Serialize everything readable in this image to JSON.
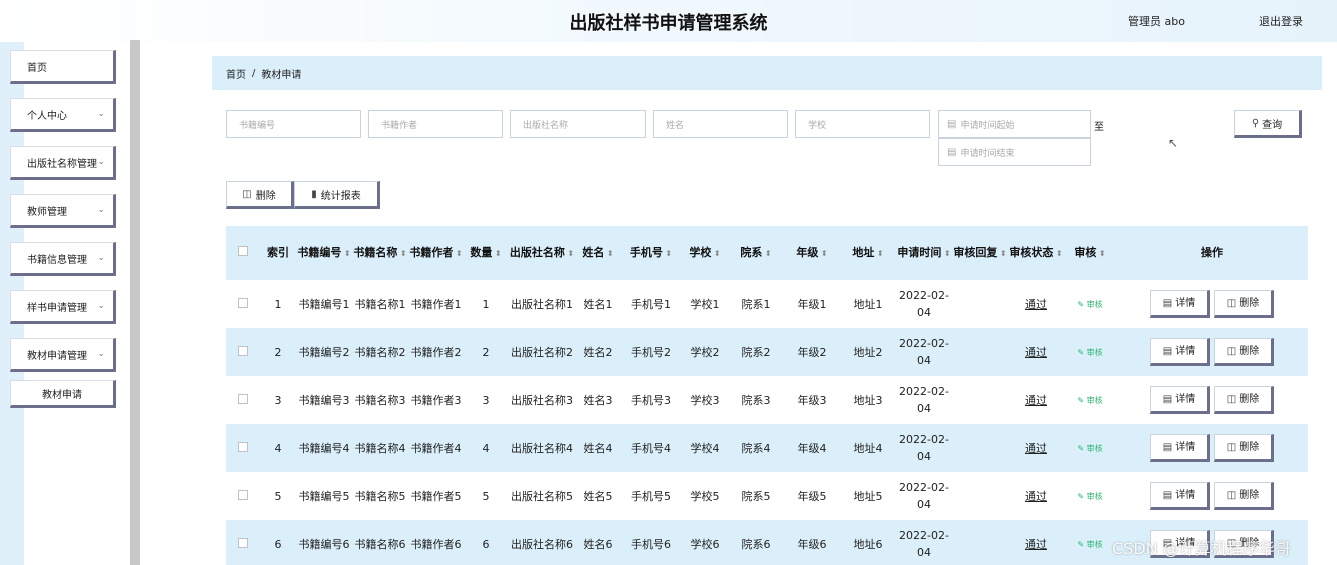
{
  "header": {
    "title": "出版社样书申请管理系统",
    "admin_label": "管理员 abo",
    "logout_label": "退出登录"
  },
  "sidebar": {
    "items": [
      {
        "label": "首页",
        "has_chevron": false
      },
      {
        "label": "个人中心",
        "has_chevron": true
      },
      {
        "label": "出版社名称管理",
        "has_chevron": true
      },
      {
        "label": "教师管理",
        "has_chevron": true
      },
      {
        "label": "书籍信息管理",
        "has_chevron": true
      },
      {
        "label": "样书申请管理",
        "has_chevron": true
      },
      {
        "label": "教材申请管理",
        "has_chevron": true
      }
    ],
    "sub_item": "教材申请"
  },
  "breadcrumb": {
    "home": "首页",
    "separator": "/",
    "current": "教材申请"
  },
  "search": {
    "book_no_placeholder": "书籍编号",
    "book_author_placeholder": "书籍作者",
    "publisher_placeholder": "出版社名称",
    "name_placeholder": "姓名",
    "school_placeholder": "学校",
    "date_start_placeholder": "申请时间起始",
    "date_end_placeholder": "申请时间结束",
    "to_label": "至",
    "query_label": "查询"
  },
  "actions": {
    "delete_label": "删除",
    "report_label": "统计报表"
  },
  "table": {
    "headers": [
      "索引",
      "书籍编号",
      "书籍名称",
      "书籍作者",
      "数量",
      "出版社名称",
      "姓名",
      "手机号",
      "学校",
      "院系",
      "年级",
      "地址",
      "申请时间",
      "审核回复",
      "审核状态",
      "审核",
      "操作"
    ],
    "rows": [
      {
        "index": "1",
        "book_no": "书籍编号1",
        "book_name": "书籍名称1",
        "author": "书籍作者1",
        "qty": "1",
        "publisher": "出版社名称1",
        "name": "姓名1",
        "phone": "手机号1",
        "school": "学校1",
        "dept": "院系1",
        "grade": "年级1",
        "address": "地址1",
        "date": "2022-02-04",
        "reply": "",
        "status": "通过",
        "audit": "审核",
        "detail": "详情",
        "delete": "删除"
      },
      {
        "index": "2",
        "book_no": "书籍编号2",
        "book_name": "书籍名称2",
        "author": "书籍作者2",
        "qty": "2",
        "publisher": "出版社名称2",
        "name": "姓名2",
        "phone": "手机号2",
        "school": "学校2",
        "dept": "院系2",
        "grade": "年级2",
        "address": "地址2",
        "date": "2022-02-04",
        "reply": "",
        "status": "通过",
        "audit": "审核",
        "detail": "详情",
        "delete": "删除"
      },
      {
        "index": "3",
        "book_no": "书籍编号3",
        "book_name": "书籍名称3",
        "author": "书籍作者3",
        "qty": "3",
        "publisher": "出版社名称3",
        "name": "姓名3",
        "phone": "手机号3",
        "school": "学校3",
        "dept": "院系3",
        "grade": "年级3",
        "address": "地址3",
        "date": "2022-02-04",
        "reply": "",
        "status": "通过",
        "audit": "审核",
        "detail": "详情",
        "delete": "删除"
      },
      {
        "index": "4",
        "book_no": "书籍编号4",
        "book_name": "书籍名称4",
        "author": "书籍作者4",
        "qty": "4",
        "publisher": "出版社名称4",
        "name": "姓名4",
        "phone": "手机号4",
        "school": "学校4",
        "dept": "院系4",
        "grade": "年级4",
        "address": "地址4",
        "date": "2022-02-04",
        "reply": "",
        "status": "通过",
        "audit": "审核",
        "detail": "详情",
        "delete": "删除"
      },
      {
        "index": "5",
        "book_no": "书籍编号5",
        "book_name": "书籍名称5",
        "author": "书籍作者5",
        "qty": "5",
        "publisher": "出版社名称5",
        "name": "姓名5",
        "phone": "手机号5",
        "school": "学校5",
        "dept": "院系5",
        "grade": "年级5",
        "address": "地址5",
        "date": "2022-02-04",
        "reply": "",
        "status": "通过",
        "audit": "审核",
        "detail": "详情",
        "delete": "删除"
      },
      {
        "index": "6",
        "book_no": "书籍编号6",
        "book_name": "书籍名称6",
        "author": "书籍作者6",
        "qty": "6",
        "publisher": "出版社名称6",
        "name": "姓名6",
        "phone": "手机号6",
        "school": "学校6",
        "dept": "院系6",
        "grade": "年级6",
        "address": "地址6",
        "date": "2022-02-04",
        "reply": "",
        "status": "通过",
        "audit": "审核",
        "detail": "详情",
        "delete": "删除"
      }
    ]
  },
  "watermark": "CSDN @计算机程序华哥"
}
